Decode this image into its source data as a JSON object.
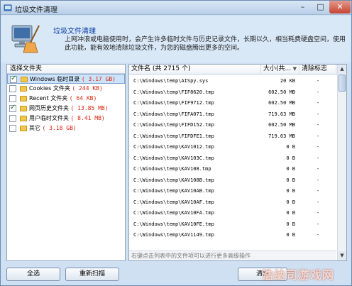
{
  "window": {
    "title": "垃圾文件清理"
  },
  "titlebar": {
    "minimize": "–",
    "maximize": "□",
    "close": "✕"
  },
  "header": {
    "title": "垃圾文件清理",
    "description": "上网冲浪或电脑使用时，会产生许多临时文件与历史记录文件，长期以久，相当耗费硬盘空间，使用此功能，能有效地清除垃圾文件，为您的磁盘腾出更多的空间。"
  },
  "left_panel": {
    "header": "选择文件夹",
    "items": [
      {
        "label": "Windows 临时目录",
        "size": "( 3.17 GB)",
        "checked": true,
        "selected": true
      },
      {
        "label": "Cookies 文件夹",
        "size": "( 244 KB)",
        "checked": false,
        "selected": false
      },
      {
        "label": "Recent 文件夹",
        "size": "( 64 KB)",
        "checked": false,
        "selected": false
      },
      {
        "label": "网页历史文件夹",
        "size": "( 13.85 MB)",
        "checked": true,
        "selected": false
      },
      {
        "label": "用户临时文件夹",
        "size": "( 8.41 MB)",
        "checked": false,
        "selected": false
      },
      {
        "label": "其它",
        "size": "( 3.18 GB)",
        "checked": false,
        "selected": false
      }
    ]
  },
  "file_list": {
    "columns": {
      "name": "文件名 (共 2715 个)",
      "size": "大小(共...",
      "flag": "清除标志"
    },
    "sort_arrow": "▼",
    "rows": [
      {
        "name": "C:\\Windows\\temp\\AISpy.sys",
        "size": "20 KB",
        "flag": "-"
      },
      {
        "name": "C:\\Windows\\temp\\FIF8620.tmp",
        "size": "602.50 MB",
        "flag": "-"
      },
      {
        "name": "C:\\Windows\\temp\\FIF9712.tmp",
        "size": "602.50 MB",
        "flag": "-"
      },
      {
        "name": "C:\\Windows\\temp\\FIFA071.tmp",
        "size": "719.63 MB",
        "flag": "-"
      },
      {
        "name": "C:\\Windows\\temp\\FIFD152.tmp",
        "size": "602.50 MB",
        "flag": "-"
      },
      {
        "name": "C:\\Windows\\temp\\FIFDFE1.tmp",
        "size": "719.63 MB",
        "flag": "-"
      },
      {
        "name": "C:\\Windows\\temp\\KAV1012.tmp",
        "size": "0 B",
        "flag": "-"
      },
      {
        "name": "C:\\Windows\\temp\\KAV103C.tmp",
        "size": "0 B",
        "flag": "-"
      },
      {
        "name": "C:\\Windows\\temp\\KAV108.tmp",
        "size": "0 B",
        "flag": "-"
      },
      {
        "name": "C:\\Windows\\temp\\KAV108B.tmp",
        "size": "0 B",
        "flag": "-"
      },
      {
        "name": "C:\\Windows\\temp\\KAV10AB.tmp",
        "size": "0 B",
        "flag": "-"
      },
      {
        "name": "C:\\Windows\\temp\\KAV10AF.tmp",
        "size": "0 B",
        "flag": "-"
      },
      {
        "name": "C:\\Windows\\temp\\KAV10FA.tmp",
        "size": "0 B",
        "flag": "-"
      },
      {
        "name": "C:\\Windows\\temp\\KAV10FE.tmp",
        "size": "0 B",
        "flag": "-"
      },
      {
        "name": "C:\\Windows\\temp\\KAV1149.tmp",
        "size": "0 B",
        "flag": "-"
      }
    ],
    "status_hint": "右键点击列表中的文件项可以进行更多高级操作"
  },
  "buttons": {
    "select_all": "全选",
    "rescan": "重新扫描",
    "clean": "清除"
  },
  "watermark": "浩纳司游戏网",
  "colors": {
    "size_text": "#d6260f",
    "header_title": "#0b3fa6",
    "window_bg": "#cfe0f3"
  }
}
